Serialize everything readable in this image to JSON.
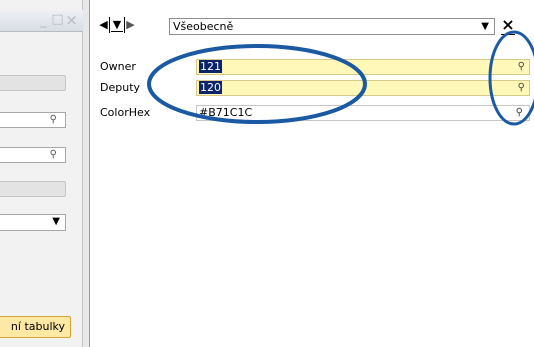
{
  "left_pane": {
    "window_buttons": {
      "minimize": "_",
      "maximize": "□",
      "close": "×"
    },
    "table_button_label": "ní tabulky"
  },
  "form": {
    "nav": {
      "first": "◀",
      "down": "▼",
      "last": "▶"
    },
    "category": "Všeobecně",
    "close_label": "×",
    "fields": [
      {
        "label": "Owner",
        "value": "121",
        "icon": "magnifier-icon"
      },
      {
        "label": "Deputy",
        "value": "120",
        "icon": "magnifier-icon"
      },
      {
        "label": "ColorHex",
        "value": "#B71C1C",
        "icon": "link-icon"
      }
    ]
  },
  "colors": {
    "field_yellow": "#fff8b8",
    "selection": "#0a246a",
    "annotation_ellipse": "#1b5aa3",
    "table_button": "#fde8a4"
  }
}
